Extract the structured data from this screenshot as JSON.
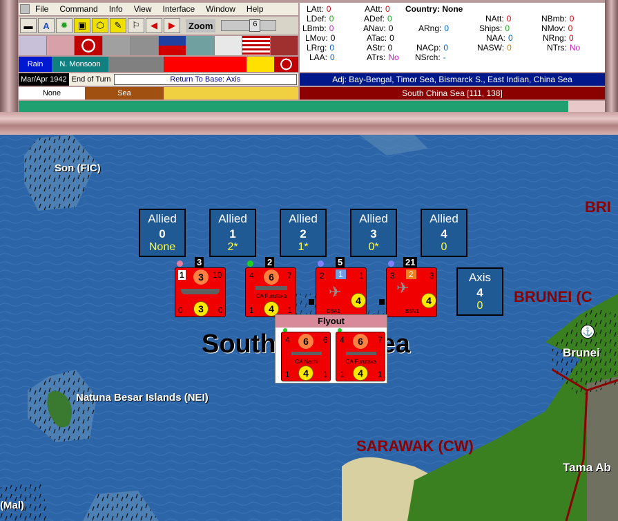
{
  "menu": [
    "File",
    "Command",
    "Info",
    "View",
    "Interface",
    "Window",
    "Help"
  ],
  "toolbar": {
    "zoom_label": "Zoom",
    "zoom_value": "6"
  },
  "weather": [
    "Rain",
    "N. Monsoon"
  ],
  "date": "Mar/Apr 1942",
  "end_of_turn": "End of Turn",
  "return_to_base": "Return To Base: Axis",
  "terrain": [
    "None",
    "Sea"
  ],
  "stats": {
    "LAtt": "0",
    "LDef": "0",
    "LBmb": "0",
    "LMov": "0",
    "LRrg": "0",
    "LAA": "0",
    "AAtt": "0",
    "ADef": "0",
    "ANav": "0",
    "ATac": "0",
    "AStr": "0",
    "ATrs": "No",
    "country_label": "Country:",
    "country": "None",
    "ARng": "0",
    "NACp": "0",
    "NSrch": "-",
    "NAtt": "0",
    "Ships": "0",
    "NAA": "0",
    "NASW": "0",
    "NBmb": "0",
    "NMov": "0",
    "NRng": "0",
    "NTrs": "No"
  },
  "adjacent": "Adj: Bay-Bengal, Timor Sea, Bismarck S., East Indian, China Sea",
  "location": "South China Sea [111, 138]",
  "map_labels": {
    "son": "Son (FIC)",
    "bri": "BRI",
    "brunei_region": "BRUNEI (C",
    "brunei": "Brunei",
    "sea": "South China Sea",
    "natuna": "Natuna Besar Islands (NEI)",
    "sarawak": "SARAWAK (CW)",
    "tama": "Tama Ab",
    "mal": "(Mal)"
  },
  "search_boxes": [
    {
      "side": "Allied",
      "num": "0",
      "val": "None"
    },
    {
      "side": "Allied",
      "num": "1",
      "val": "2*"
    },
    {
      "side": "Allied",
      "num": "2",
      "val": "1*"
    },
    {
      "side": "Allied",
      "num": "3",
      "val": "0*"
    },
    {
      "side": "Allied",
      "num": "4",
      "val": "0"
    },
    {
      "side": "Axis",
      "num": "4",
      "val": "0"
    }
  ],
  "counters": [
    {
      "stack": "3",
      "tl": "1",
      "tc": "3",
      "tr": "10",
      "bl": "0",
      "bc": "3",
      "br": "0",
      "name": ""
    },
    {
      "stack": "2",
      "tl": "4",
      "tc": "6",
      "tr": "7",
      "bl": "1",
      "bc": "4",
      "br": "1",
      "name": "CA Furutaka"
    },
    {
      "stack": "5",
      "tl": "2",
      "tc": "1",
      "tr": "1",
      "bl": "",
      "bc": "4",
      "br": "",
      "name": "D3A1"
    },
    {
      "stack": "21",
      "tl": "3",
      "tc": "2",
      "tr": "3",
      "bl": "",
      "bc": "4",
      "br": "",
      "name": "B5N1"
    }
  ],
  "flyout": {
    "title": "Flyout",
    "units": [
      {
        "tl": "4",
        "tc": "6",
        "tr": "6",
        "bl": "1",
        "bc": "4",
        "br": "1",
        "name": "CA Nachi"
      },
      {
        "tl": "4",
        "tc": "6",
        "tr": "7",
        "bl": "1",
        "bc": "4",
        "br": "1",
        "name": "CA Furutaka"
      }
    ]
  },
  "colors": {
    "counter_red": "#f00000",
    "box_blue": "#1f5a95",
    "adj_blue": "#00188a",
    "loc_red": "#8b0000"
  }
}
